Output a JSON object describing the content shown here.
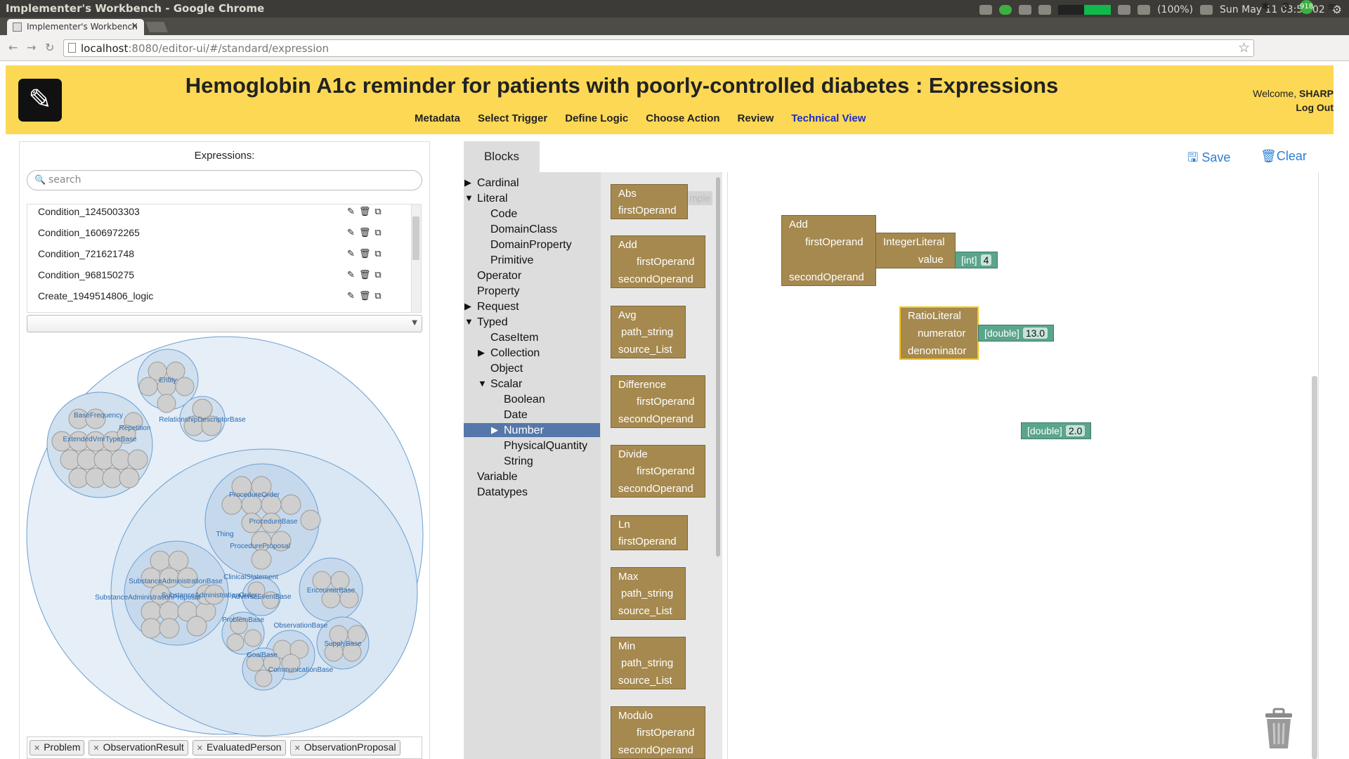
{
  "os": {
    "window_title": "Implementer's Workbench - Google Chrome",
    "battery": "(100%)",
    "datetime": "Sun May 11  03:54:02",
    "chrome_badge": "918"
  },
  "browser": {
    "tab_title": "Implementer's Workbench",
    "tab_close": "×",
    "url_host": "localhost",
    "url_rest": ":8080/editor-ui/#/standard/expression"
  },
  "header": {
    "title": "Hemoglobin A1c reminder for patients with poorly-controlled diabetes : Expressions",
    "nav": [
      "Metadata",
      "Select Trigger",
      "Define Logic",
      "Choose Action",
      "Review",
      "Technical View"
    ],
    "active_nav": "Technical View",
    "welcome_prefix": "Welcome, ",
    "username": "SHARP",
    "logout": "Log Out",
    "accent_color": "#fdd855"
  },
  "expressions": {
    "title": "Expressions:",
    "search_placeholder": "search",
    "items": [
      {
        "name": "Condition_1245003303"
      },
      {
        "name": "Condition_1606972265"
      },
      {
        "name": "Condition_721621748"
      },
      {
        "name": "Condition_968150275"
      },
      {
        "name": "Create_1949514806_logic"
      }
    ],
    "action_icons": [
      "pencil-icon",
      "trash-icon",
      "copy-icon"
    ]
  },
  "pack_labels": {
    "entity": "Entity",
    "basefreq": "BaseFrequency",
    "repetition": "Repetition",
    "relationship": "RelationshipDescriptorBase",
    "extended": "ExtendedVmrTypeBase",
    "procorder": "ProcedureOrder",
    "procbase": "ProcedureBase",
    "thing": "Thing",
    "procproposal": "ProcedureProposal",
    "clinical": "ClinicalStatement",
    "subadminbase": "SubstanceAdministrationBase",
    "subadminorder": "SubstanceAdministrationOrder",
    "subadminproposal": "SubstanceAdministrationProposal",
    "adverse": "AdverseEventBase",
    "encounter": "EncounterBase",
    "problem": "ProblemBase",
    "observation": "ObservationBase",
    "supply": "SupplyBase",
    "goal": "GoalBase",
    "communication": "CommunicationBase"
  },
  "filter_tags": [
    "Problem",
    "ObservationResult",
    "EvaluatedPerson",
    "ObservationProposal"
  ],
  "blocks_panel": {
    "tab": "Blocks",
    "save": "Save",
    "clear": "Clear",
    "tree": {
      "cardinal": "Cardinal",
      "literal": "Literal",
      "code": "Code",
      "domainclass": "DomainClass",
      "domainproperty": "DomainProperty",
      "primitive": "Primitive",
      "operator": "Operator",
      "property": "Property",
      "request": "Request",
      "typed": "Typed",
      "caseitem": "CaseItem",
      "collection": "Collection",
      "object": "Object",
      "scalar": "Scalar",
      "boolean": "Boolean",
      "date": "Date",
      "number": "Number",
      "physicalquantity": "PhysicalQuantity",
      "string": "String",
      "variable": "Variable",
      "datatypes": "Datatypes"
    },
    "selected": "Number"
  },
  "flyout": {
    "ghost": "mple",
    "abs": "Abs",
    "abs_op": "firstOperand",
    "add": "Add",
    "add_op1": "firstOperand",
    "add_op2": "secondOperand",
    "avg": "Avg",
    "avg_p": "path_string",
    "avg_s": "source_List",
    "diff": "Difference",
    "diff_op1": "firstOperand",
    "diff_op2": "secondOperand",
    "div": "Divide",
    "div_op1": "firstOperand",
    "div_op2": "secondOperand",
    "ln": "Ln",
    "ln_op": "firstOperand",
    "max": "Max",
    "max_p": "path_string",
    "max_s": "source_List",
    "min": "Min",
    "min_p": "path_string",
    "min_s": "source_List",
    "mod": "Modulo",
    "mod_op1": "firstOperand",
    "mod_op2": "secondOperand"
  },
  "workspace": {
    "add": "Add",
    "add_op1": "firstOperand",
    "add_op2": "secondOperand",
    "intlit": "IntegerLiteral",
    "intlit_value": "value",
    "int_type": "[int]",
    "int_val": "4",
    "ratio": "RatioLiteral",
    "ratio_num": "numerator",
    "ratio_den": "denominator",
    "dbl_type": "[double]",
    "dbl_val1": "13.0",
    "dbl_val2": "2.0",
    "block_color": "#a5894f",
    "literal_color": "#5ba58c"
  }
}
